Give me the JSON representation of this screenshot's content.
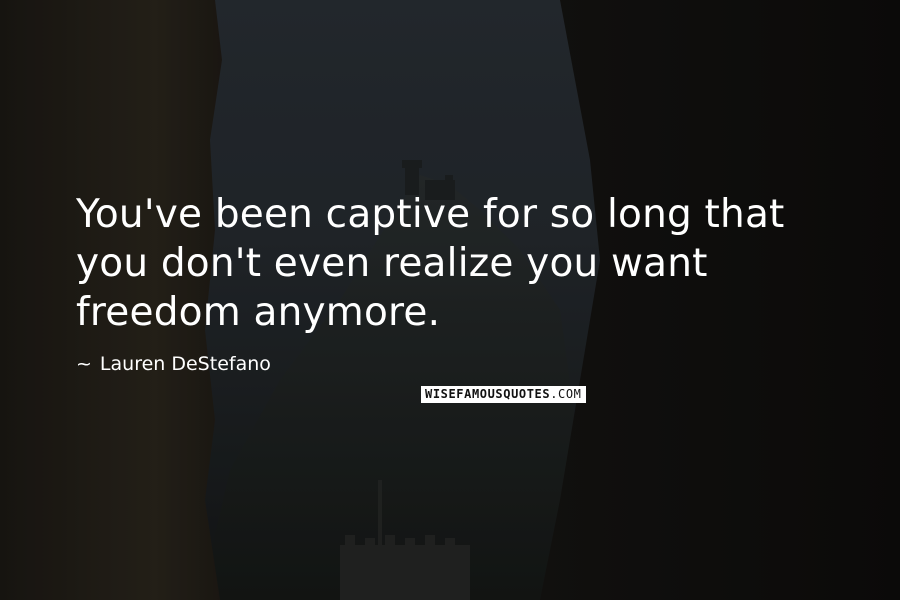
{
  "quote": {
    "text": "You've been captive for so long that you don't even realize you want freedom anymore."
  },
  "author": {
    "dash": "~",
    "name": "Lauren DeStefano"
  },
  "watermark": {
    "brand_bold": "WISEFAMOUSQUOTES",
    "brand_light": ".COM"
  },
  "colors": {
    "text": "#ffffff",
    "sky": "#2a3036",
    "rock": "#141412"
  }
}
